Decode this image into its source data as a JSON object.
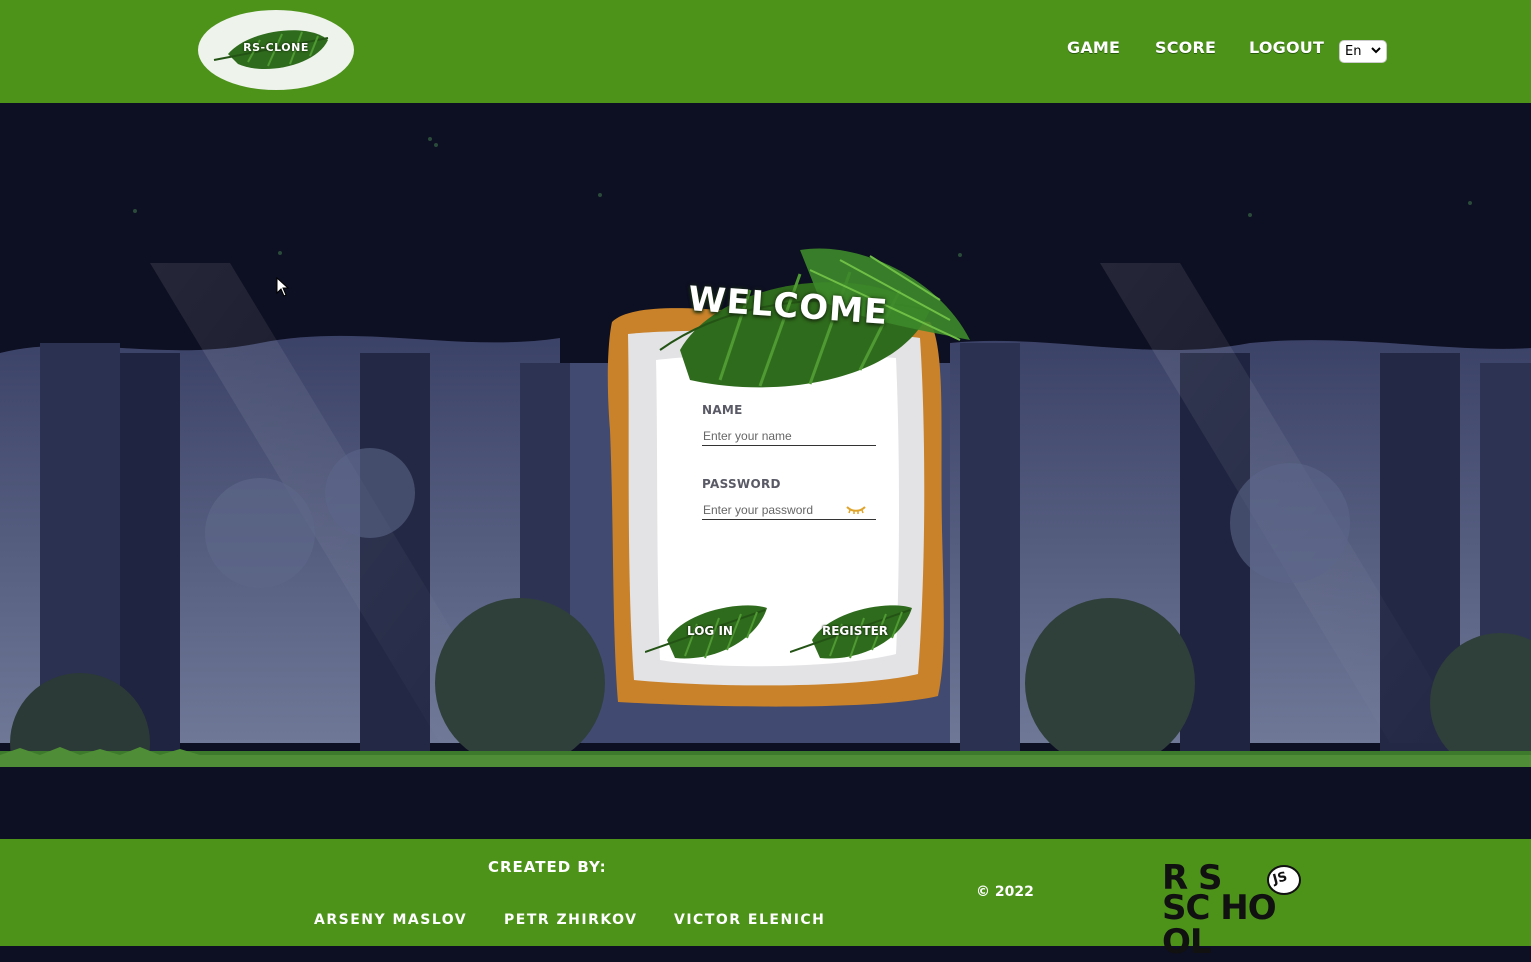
{
  "header": {
    "logo_text": "RS-CLONE",
    "nav": [
      {
        "label": "GAME"
      },
      {
        "label": "SCORE"
      },
      {
        "label": "LOGOUT"
      }
    ],
    "language": "En"
  },
  "card": {
    "title": "WELCOME",
    "name_label": "NAME",
    "name_placeholder": "Enter your name",
    "password_label": "PASSWORD",
    "password_placeholder": "Enter your password",
    "login_label": "LOG IN",
    "register_label": "REGISTER"
  },
  "footer": {
    "created_by": "CREATED BY:",
    "authors": [
      "Arseny Maslov",
      "Petr Zhirkov",
      "Victor Elenich"
    ],
    "copyright": "© 2022",
    "school_logo": {
      "line1": "R S",
      "badge": "JS",
      "line2": "SC HO OL"
    }
  },
  "colors": {
    "header_bg": "#4d931a",
    "scene_bg": "#0d0f22",
    "frame_orange": "#c9822a"
  }
}
